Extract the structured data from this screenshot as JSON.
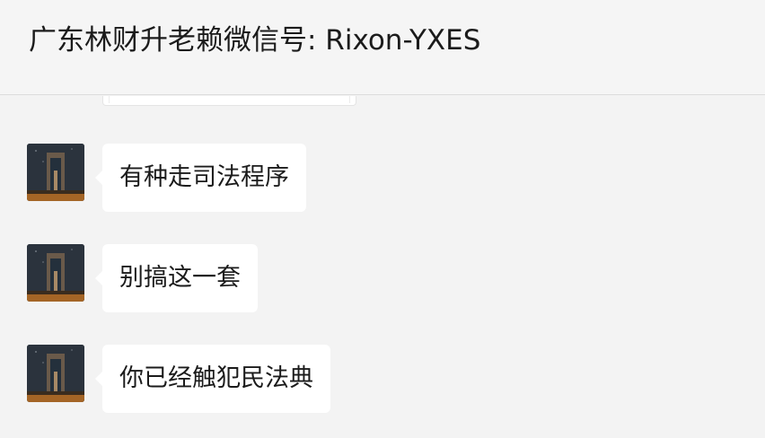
{
  "header": {
    "title": "广东林财升老赖微信号: Rixon-YXES"
  },
  "messages": [
    {
      "text": "有种走司法程序",
      "avatar": "photo-avatar-icon"
    },
    {
      "text": "别搞这一套",
      "avatar": "photo-avatar-icon"
    },
    {
      "text": "你已经触犯民法典",
      "avatar": "photo-avatar-icon"
    }
  ]
}
